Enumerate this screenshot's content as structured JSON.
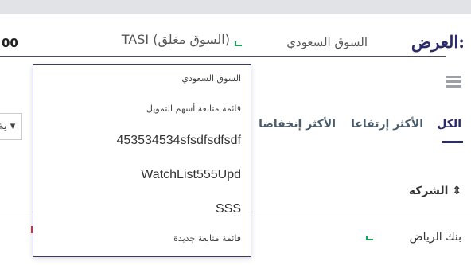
{
  "header": {
    "view_label": "العرض:",
    "market": "السوق السعودي",
    "index_text": "TASI (السوق مغلق)",
    "left_digits": "00"
  },
  "tabs": [
    {
      "label": "الكل",
      "active": true
    },
    {
      "label": "الأكثر إرتفاعا",
      "active": false
    },
    {
      "label": "الأكثر إنخفاضا",
      "active": false
    }
  ],
  "filter_select": {
    "value": "ية ▾"
  },
  "table": {
    "column_company": "الشركة ⇕",
    "rows": [
      {
        "company": "بنك الرياض"
      }
    ]
  },
  "dropdown": {
    "items": [
      "السوق السعودي",
      "قائمة متابعة أسهم التمويل",
      "453534534sfsdfsdfsdf",
      "WatchList555Upd",
      "SSS",
      "قائمة متابعة جديدة"
    ]
  },
  "icons": {
    "menu": "hamburger-icon",
    "status_up": "green-corner-icon",
    "status_down": "red-tick-icon"
  },
  "colors": {
    "accent": "#2b2b6a",
    "positive": "#19a05a",
    "negative": "#dd3333"
  }
}
